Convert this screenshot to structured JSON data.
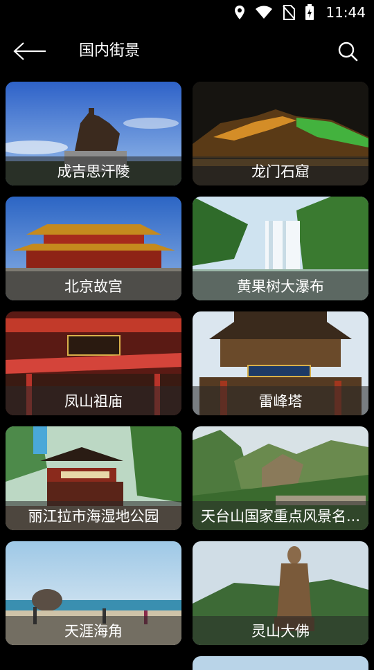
{
  "status_bar": {
    "time": "11:44",
    "icons": [
      "location-icon",
      "wifi-icon",
      "no-sim-icon",
      "battery-charging-icon"
    ]
  },
  "app_bar": {
    "title": "国内街景",
    "back_icon": "arrow-left-icon",
    "search_icon": "search-icon"
  },
  "scenic_spots": [
    {
      "name": "成吉思汗陵"
    },
    {
      "name": "龙门石窟"
    },
    {
      "name": "北京故宫"
    },
    {
      "name": "黄果树大瀑布"
    },
    {
      "name": "凤山祖庙"
    },
    {
      "name": "雷峰塔"
    },
    {
      "name": "丽江拉市海湿地公园"
    },
    {
      "name": "天台山国家重点风景名..."
    },
    {
      "name": "天涯海角"
    },
    {
      "name": "灵山大佛"
    }
  ],
  "colors": {
    "background": "#000000",
    "caption_overlay": "rgba(40,40,40,0.55)",
    "text": "#ffffff"
  }
}
